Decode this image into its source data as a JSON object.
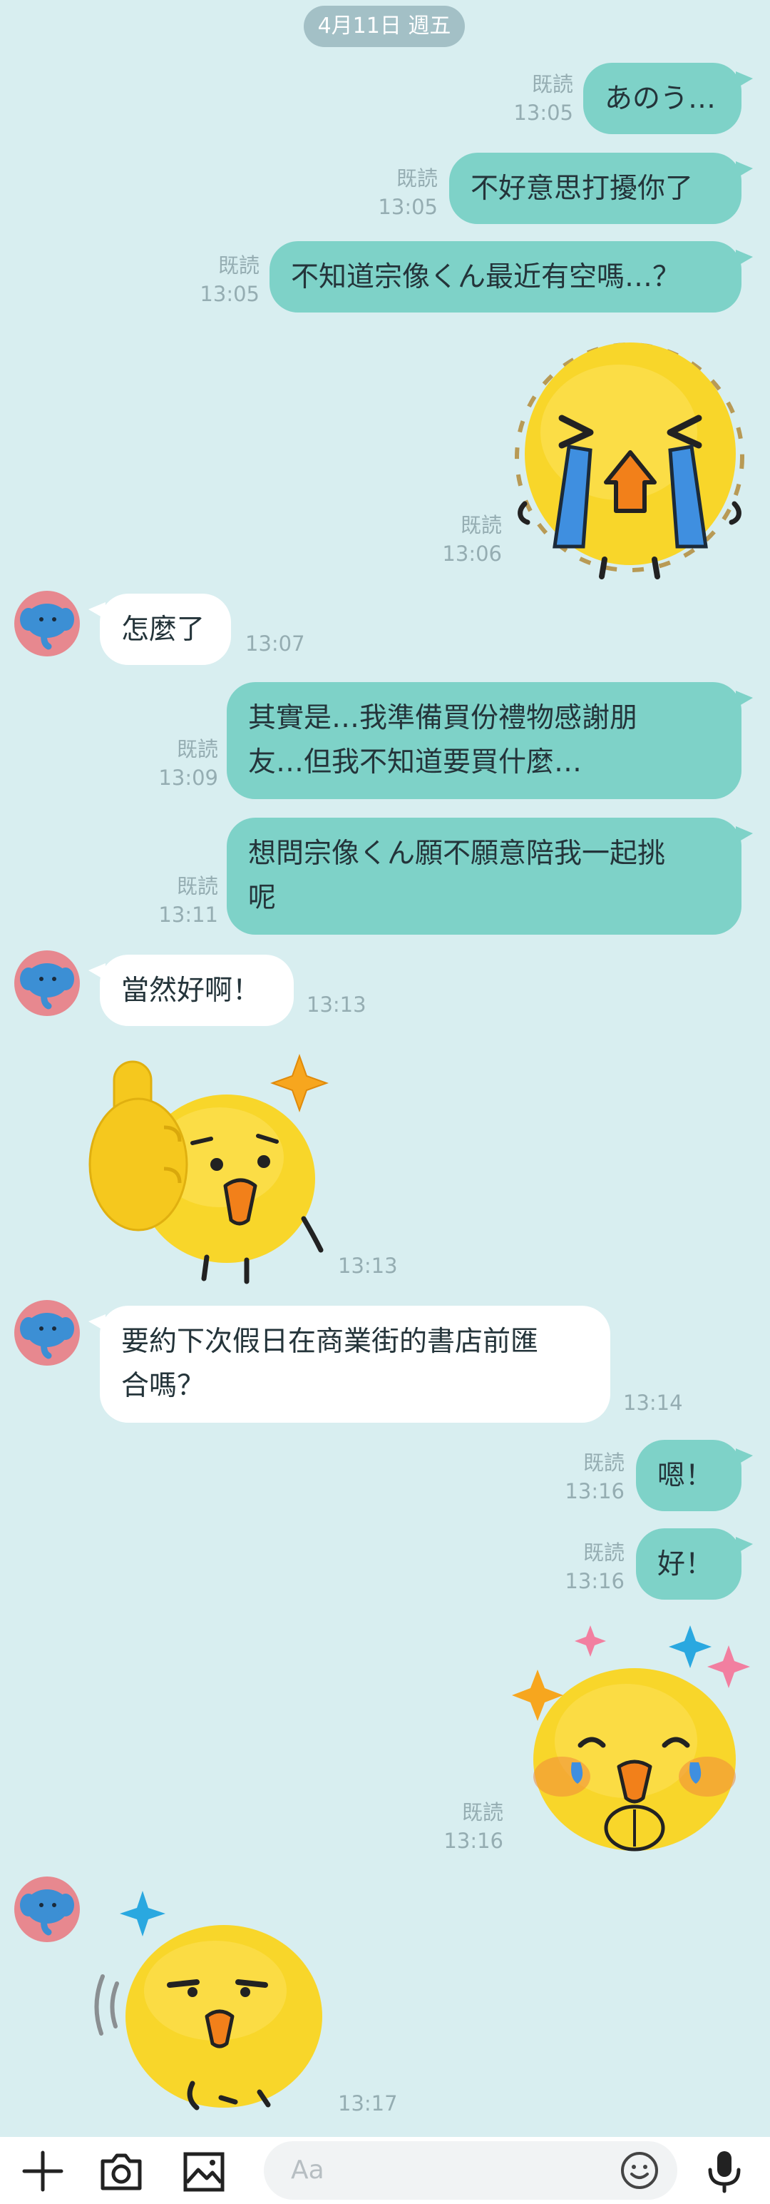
{
  "chat": {
    "date_separator": "4月11日 週五",
    "messages": [
      {
        "type": "text",
        "side": "out",
        "text": "あのう…",
        "read": "既読",
        "time": "13:05"
      },
      {
        "type": "text",
        "side": "out",
        "text": "不好意思打擾你了",
        "read": "既読",
        "time": "13:05"
      },
      {
        "type": "text",
        "side": "out",
        "text": "不知道宗像くん最近有空嗎…？",
        "read": "既読",
        "time": "13:05"
      },
      {
        "type": "sticker",
        "side": "out",
        "sticker": "crying-blob-sticker",
        "read": "既読",
        "time": "13:06"
      },
      {
        "type": "text",
        "side": "in",
        "text": "怎麼了",
        "time": "13:07"
      },
      {
        "type": "text",
        "side": "out",
        "text": "其實是…我準備買份禮物感謝朋\n友…但我不知道要買什麼…",
        "read": "既読",
        "time": "13:09"
      },
      {
        "type": "text",
        "side": "out",
        "text": "想問宗像くん願不願意陪我一起挑\n呢",
        "read": "既読",
        "time": "13:11"
      },
      {
        "type": "text",
        "side": "in",
        "text": "當然好啊！",
        "time": "13:13"
      },
      {
        "type": "sticker",
        "side": "in",
        "sticker": "thumbs-up-blob-sticker",
        "time": "13:13"
      },
      {
        "type": "text",
        "side": "in",
        "text": "要約下次假日在商業街的書店前匯\n合嗎？",
        "time": "13:14"
      },
      {
        "type": "text",
        "side": "out",
        "text": "嗯！",
        "read": "既読",
        "time": "13:16"
      },
      {
        "type": "text",
        "side": "out",
        "text": "好！",
        "read": "既読",
        "time": "13:16"
      },
      {
        "type": "sticker",
        "side": "out",
        "sticker": "touched-blob-sticker",
        "read": "既読",
        "time": "13:16"
      },
      {
        "type": "sticker",
        "side": "in",
        "sticker": "waving-blob-sticker",
        "time": "13:17"
      }
    ]
  },
  "input_bar": {
    "placeholder": "Aa",
    "icons": [
      "plus-icon",
      "camera-icon",
      "image-icon",
      "emoji-icon",
      "microphone-icon"
    ]
  },
  "colors": {
    "background": "#d8eef0",
    "outgoing_bubble": "#7ed2c8",
    "incoming_bubble": "#ffffff",
    "meta_text": "#95adb2",
    "avatar_bg": "#e7888f"
  }
}
